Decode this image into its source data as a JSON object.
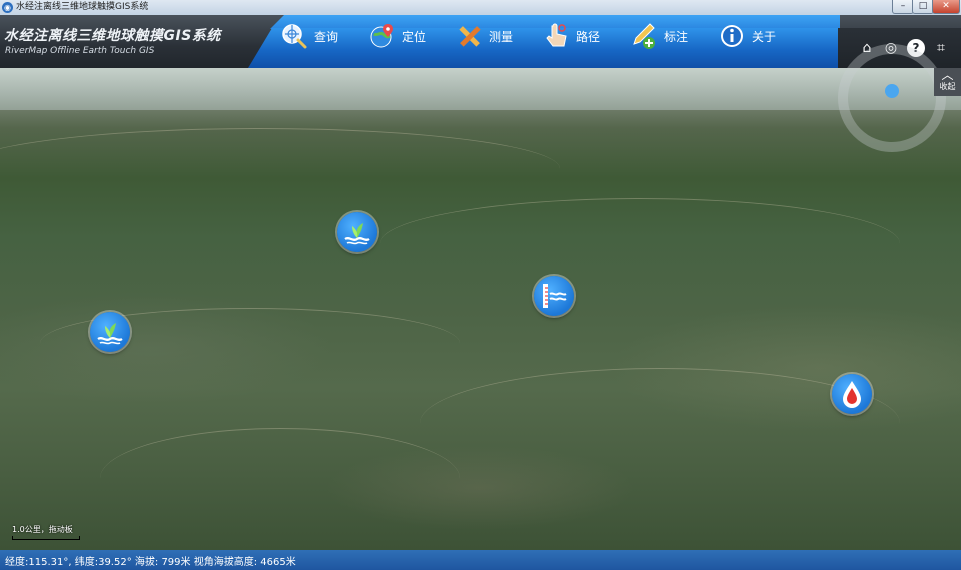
{
  "window": {
    "title": "水经注离线三维地球触摸GIS系统",
    "controls": {
      "minimize": "–",
      "maximize": "□",
      "close": "✕"
    }
  },
  "header": {
    "title": "水经注离线三维地球触摸GIS系统",
    "subtitle": "RiverMap Offline Earth Touch GIS"
  },
  "nav": [
    {
      "label": "查询",
      "icon": "globe-search-icon"
    },
    {
      "label": "定位",
      "icon": "globe-locate-icon"
    },
    {
      "label": "测量",
      "icon": "measure-tools-icon"
    },
    {
      "label": "路径",
      "icon": "hand-path-icon"
    },
    {
      "label": "标注",
      "icon": "pencil-add-icon"
    },
    {
      "label": "关于",
      "icon": "info-icon"
    }
  ],
  "tools": {
    "home": "⌂",
    "globe": "◎",
    "help": "?",
    "crop": "⌗"
  },
  "map": {
    "collapse_label": "收起",
    "scale_label": "1.0公里，拖动板",
    "pois": [
      {
        "type": "wetland-icon"
      },
      {
        "type": "wetland-icon"
      },
      {
        "type": "water-gauge-icon"
      },
      {
        "type": "water-drop-icon"
      }
    ]
  },
  "status": {
    "text": "经度:115.31°, 纬度:39.52°  海拔: 799米   视角海拔高度: 4665米"
  },
  "colors": {
    "nav_blue": "#1767c5",
    "status_blue": "#1f56a0",
    "poi_blue": "#1d78d8"
  }
}
